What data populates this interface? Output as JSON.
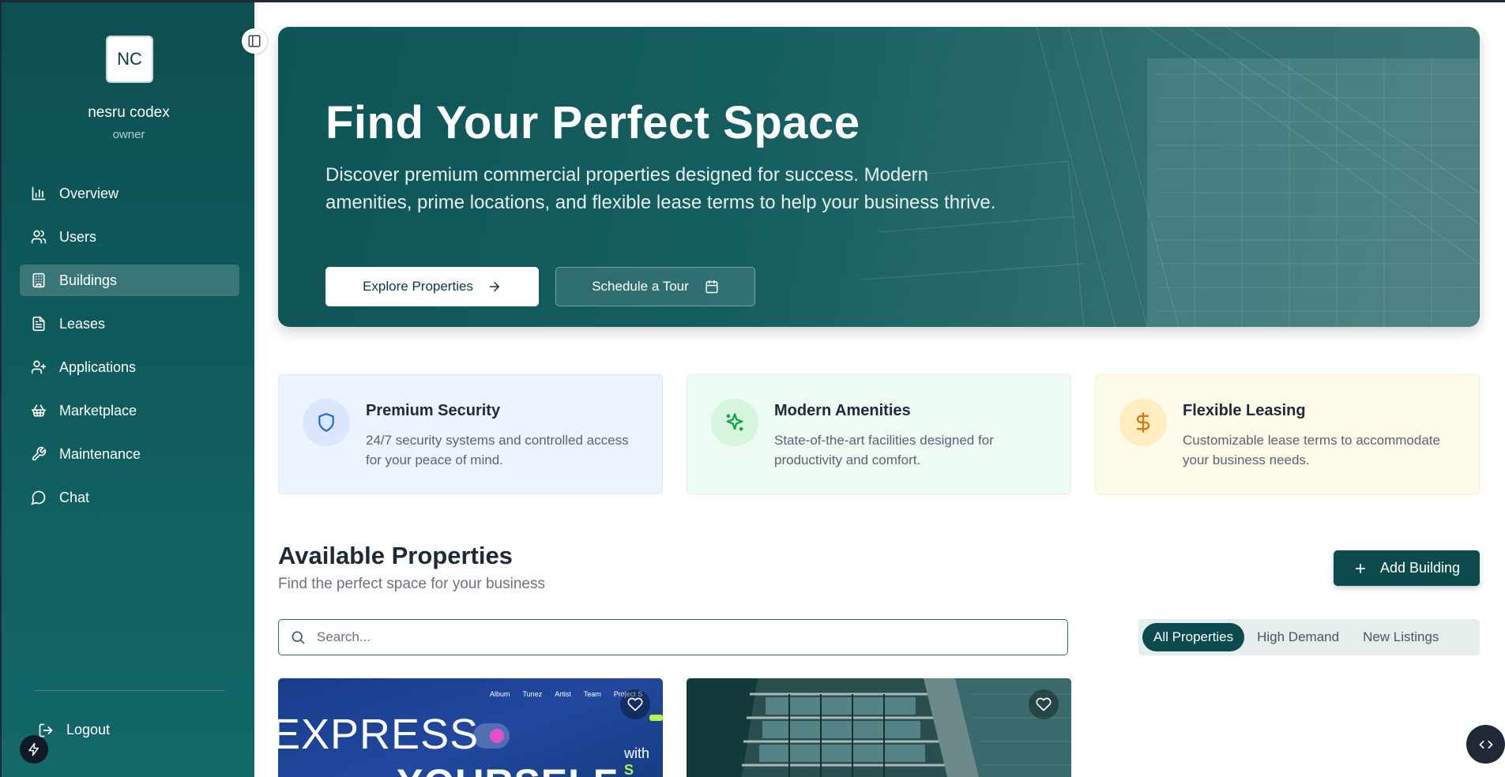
{
  "user": {
    "initials": "NC",
    "name": "nesru codex",
    "role": "owner"
  },
  "sidebar": {
    "items": [
      {
        "label": "Overview",
        "icon": "bar-chart-icon",
        "active": false
      },
      {
        "label": "Users",
        "icon": "users-icon",
        "active": false
      },
      {
        "label": "Buildings",
        "icon": "building-icon",
        "active": true
      },
      {
        "label": "Leases",
        "icon": "file-text-icon",
        "active": false
      },
      {
        "label": "Applications",
        "icon": "user-plus-icon",
        "active": false
      },
      {
        "label": "Marketplace",
        "icon": "basket-icon",
        "active": false
      },
      {
        "label": "Maintenance",
        "icon": "wrench-icon",
        "active": false
      },
      {
        "label": "Chat",
        "icon": "message-circle-icon",
        "active": false
      }
    ],
    "logout_label": "Logout"
  },
  "hero": {
    "title": "Find Your Perfect Space",
    "subtitle": "Discover premium commercial properties designed for success. Modern amenities, prime locations, and flexible lease terms to help your business thrive.",
    "explore_label": "Explore Properties",
    "tour_label": "Schedule a Tour"
  },
  "features": [
    {
      "title": "Premium Security",
      "text": "24/7 security systems and controlled access for your peace of mind.",
      "icon": "shield-icon",
      "color": "#2563eb"
    },
    {
      "title": "Modern Amenities",
      "text": "State-of-the-art facilities designed for productivity and comfort.",
      "icon": "sparkles-icon",
      "color": "#16a34a"
    },
    {
      "title": "Flexible Leasing",
      "text": "Customizable lease terms to accommodate your business needs.",
      "icon": "dollar-icon",
      "color": "#d97706"
    }
  ],
  "properties_section": {
    "title": "Available Properties",
    "subtitle": "Find the perfect space for your business",
    "add_label": "Add Building",
    "search_placeholder": "Search...",
    "filters": [
      "All Properties",
      "High Demand",
      "New Listings"
    ],
    "active_filter": "All Properties"
  },
  "property_cards": [
    {
      "image_text": {
        "nav": [
          "Album",
          "Tunez",
          "Artist",
          "Team",
          "Project S"
        ],
        "line1": "EXPRESS",
        "line2": "YOURSELF",
        "with": "with",
        "with_accent": "S"
      }
    },
    {
      "image_text": {}
    }
  ],
  "colors": {
    "sidebar": "#0f5a5d",
    "primary": "#0c4a4d",
    "accent_blue": "#2563eb",
    "accent_green": "#16a34a",
    "accent_amber": "#d97706"
  }
}
